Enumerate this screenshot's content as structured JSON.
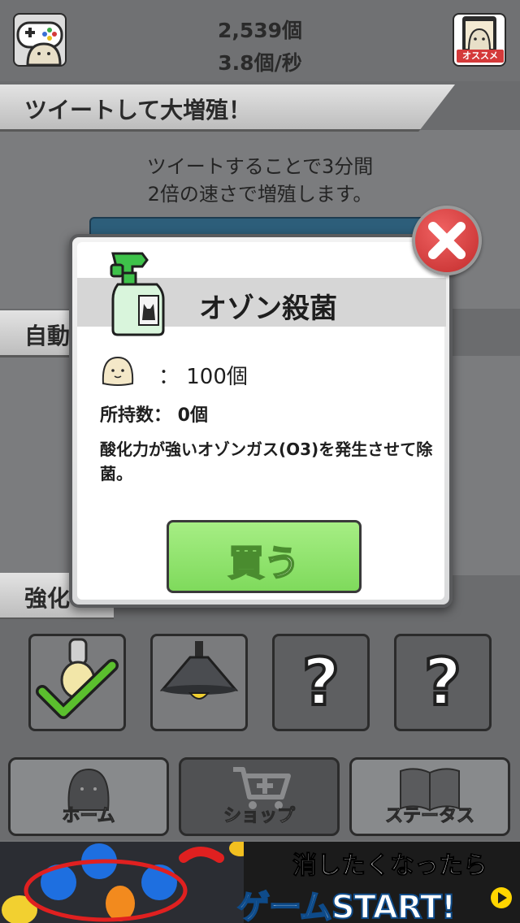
{
  "header": {
    "total_count": "2,539個",
    "rate": "3.8個/秒",
    "recommend_label": "オススメ"
  },
  "sections": {
    "tweet": {
      "title": "ツイートして大増殖！",
      "description_line1": "ツイートすることで3分間",
      "description_line2": "2倍の速さで増殖します。"
    },
    "auto_partial": "自動",
    "upgrade_partial": "強化"
  },
  "modal": {
    "item_name": "オゾン殺菌",
    "price": "：  100個",
    "owned": "所持数：  0個",
    "description": "酸化力が強いオゾンガス(O3)を発生させて除菌。",
    "buy_label": "買う",
    "bottle_label_color": "#6cd66c"
  },
  "nav": {
    "home_label": "ホーム",
    "shop_label": "ショップ",
    "status_label": "ステータス",
    "selected": "shop"
  },
  "ad": {
    "line1": "消したくなったら",
    "line2": "ゲームSTART!"
  },
  "colors": {
    "accent_red": "#d43a3a",
    "buy_green": "#8ee26a",
    "tweet_blue": "#2d5e7a"
  }
}
